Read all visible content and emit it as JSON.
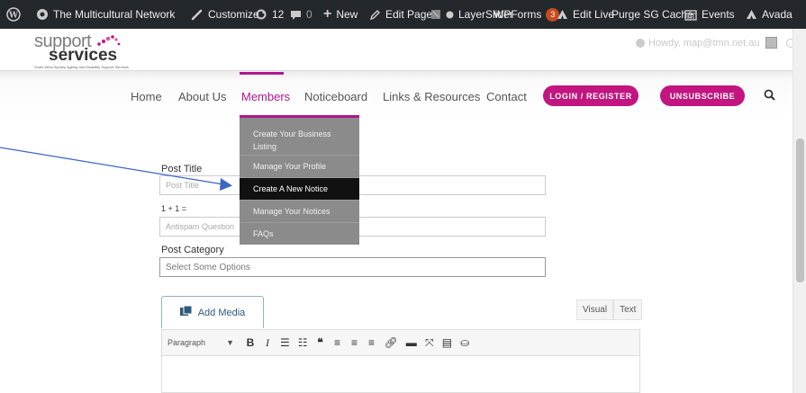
{
  "admin_bar": {
    "site_name": "The Multicultural Network",
    "customize": "Customize",
    "updates_count": "12",
    "comments_count": "0",
    "new": "New",
    "edit_page": "Edit Page",
    "layerslider": "LayerSlider",
    "wpforms": "WPForms",
    "wpforms_count": "3",
    "edit_live": "Edit Live",
    "purge_cache": "Purge SG Cache",
    "events": "Events",
    "avada": "Avada"
  },
  "header": {
    "logo_line1": "support",
    "logo_line2": "services",
    "logo_tagline": "South West Sydney Ageing and Disability Support Services",
    "howdy": "Howdy, map@tmn.net.au"
  },
  "nav": {
    "items": [
      "Home",
      "About Us",
      "Members",
      "Noticeboard",
      "Links & Resources",
      "Contact"
    ],
    "login_button": "LOGIN / REGISTER",
    "unsubscribe_button": "UNSUBSCRIBE"
  },
  "dropdown": {
    "items": [
      "Create Your Business Listing",
      "Manage Your Profile",
      "Create A New Notice",
      "Manage Your Notices",
      "FAQs"
    ]
  },
  "form": {
    "post_title_label": "Post Title",
    "post_title_placeholder": "Post Title",
    "antispam_label": "1 + 1 =",
    "antispam_placeholder": "Antispam Question",
    "category_label": "Post Category",
    "category_value": "Select Some Options"
  },
  "editor": {
    "add_media": "Add Media",
    "tab_visual": "Visual",
    "tab_text": "Text",
    "format_select": "Paragraph",
    "bold": "B",
    "italic": "I"
  },
  "colors": {
    "brand": "#b0178f",
    "button": "#c2157f",
    "admin_bar": "#23282d"
  }
}
